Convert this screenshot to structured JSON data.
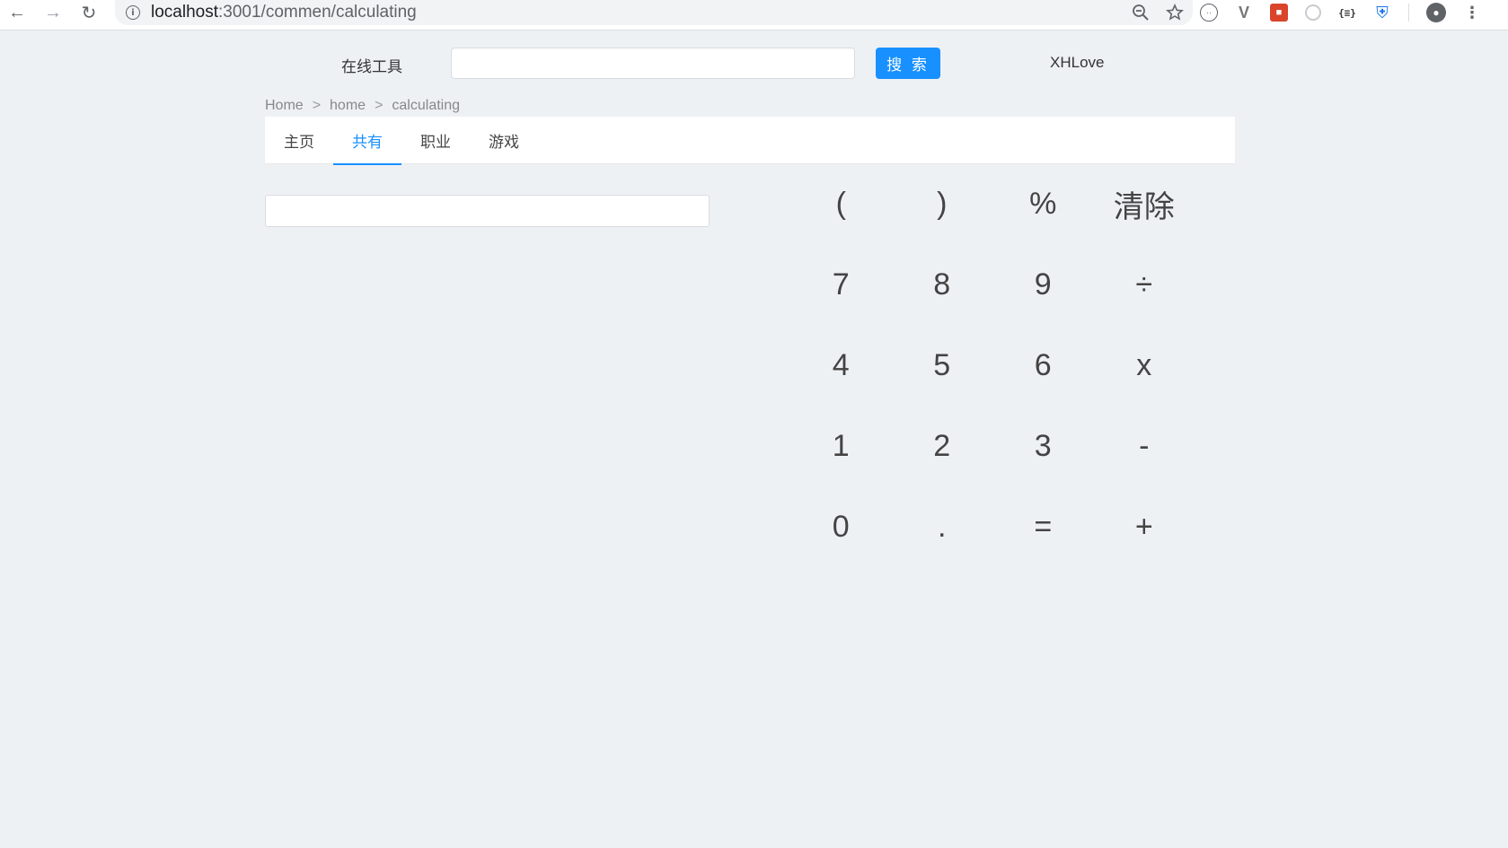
{
  "browser": {
    "url_host": "localhost",
    "url_path": ":3001/commen/calculating",
    "info_glyph": "i",
    "ext_json_label": "{≡}"
  },
  "header": {
    "site_title": "在线工具",
    "search_placeholder": "",
    "search_button": "搜 索",
    "user_name": "XHLove"
  },
  "breadcrumb": {
    "items": [
      "Home",
      "home",
      "calculating"
    ],
    "separator": ">"
  },
  "tabs": [
    {
      "label": "主页",
      "active": false
    },
    {
      "label": "共有",
      "active": true
    },
    {
      "label": "职业",
      "active": false
    },
    {
      "label": "游戏",
      "active": false
    }
  ],
  "calculator": {
    "display_value": "",
    "keys": [
      [
        "(",
        ")",
        "%",
        "清除"
      ],
      [
        "7",
        "8",
        "9",
        "÷"
      ],
      [
        "4",
        "5",
        "6",
        "x"
      ],
      [
        "1",
        "2",
        "3",
        "-"
      ],
      [
        "0",
        ".",
        "=",
        "+"
      ]
    ]
  }
}
